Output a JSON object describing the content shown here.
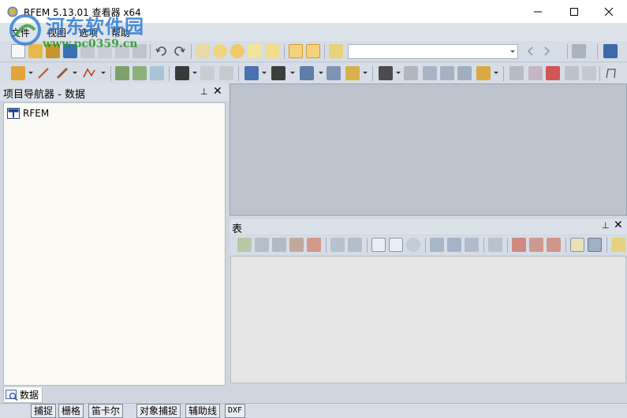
{
  "window": {
    "title": "RFEM 5.13.01 查看器 x64",
    "min_glyph": "—",
    "max_glyph": "☐",
    "close_glyph": "✕"
  },
  "watermark": {
    "title": "河东软件园",
    "url": "www.pc0359.cn"
  },
  "menu": [
    "文件",
    "视图",
    "选项",
    "帮助"
  ],
  "toolbar1": {
    "combo_value": "",
    "icons": [
      "new-icon",
      "open-icon",
      "open-folder-icon",
      "model-icon",
      "save-icon",
      "save-disabled-icon",
      "print-icon",
      "print-preview-icon",
      "undo-icon",
      "redo-icon",
      "eraser-icon",
      "search-icon",
      "target-icon",
      "comment-icon",
      "copy-icon",
      "table-view-icon",
      "grid-view-icon",
      "load-case-icon",
      "prev-icon",
      "next-icon",
      "line-end-icon",
      "calculator-icon",
      "export-icon"
    ]
  },
  "toolbar2": {
    "icons": [
      "node-icon",
      "line-icon",
      "member-icon",
      "polyline-icon",
      "support-icon",
      "hinge-icon",
      "surface-icon",
      "load-icon",
      "slab-icon",
      "beam-load-icon",
      "frame-icon",
      "surface-load-icon",
      "solid-icon",
      "block-icon",
      "connect-icon",
      "select-icon",
      "grid-icon",
      "mesh-icon",
      "result-icon",
      "display-icon",
      "zoom-icon",
      "zoom-in-icon",
      "box-icon",
      "cube-icon",
      "axis-icon"
    ]
  },
  "navigator": {
    "title": "项目导航器 - 数据",
    "tree_root": "RFEM",
    "tab_label": "数据",
    "pin_glyph": "ᵖ",
    "close_glyph": "✕"
  },
  "table_panel": {
    "title": "表",
    "pin_glyph": "ᵖ",
    "close_glyph": "✕",
    "icons": [
      "table-filter-icon",
      "insert-row-icon",
      "delete-row-icon",
      "move-row-icon",
      "edit-icon",
      "prev-table-icon",
      "next-table-icon",
      "undo-icon",
      "redo-icon",
      "refresh-icon",
      "add-icon",
      "copy-icon",
      "export-icon",
      "clear-icon",
      "cut-icon",
      "left-icon",
      "right-icon",
      "column-icon",
      "rows-icon",
      "settings-icon"
    ]
  },
  "statusbar": [
    "捕捉",
    "栅格",
    "笛卡尔",
    "对象捕捉",
    "辅助线",
    "DXF"
  ]
}
